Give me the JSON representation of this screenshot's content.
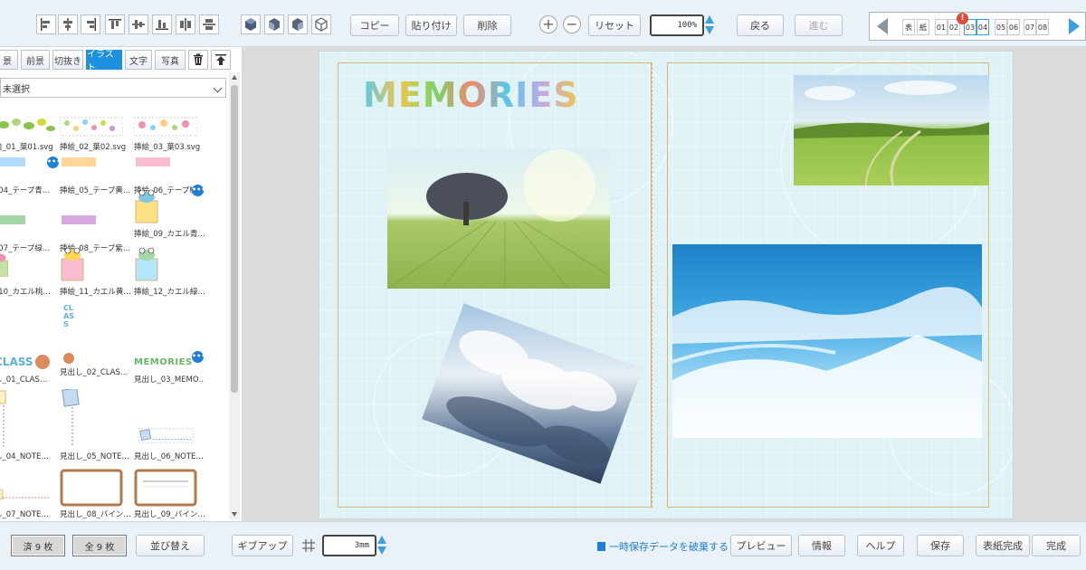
{
  "toolbar": {
    "align_icons": [
      "align-left-icon",
      "align-center-h-icon",
      "align-right-icon",
      "align-top-icon",
      "align-center-v-icon",
      "align-bottom-icon",
      "distribute-h-icon",
      "distribute-v-icon"
    ],
    "layer_icons": [
      "bring-to-front-icon",
      "bring-forward-icon",
      "send-backward-icon",
      "send-to-back-icon"
    ],
    "copy": "コピー",
    "paste": "貼り付け",
    "delete": "削除",
    "reset": "リセット",
    "zoom": "100%",
    "back": "戻る",
    "forward": "進む"
  },
  "page_nav": {
    "cover_front": "表",
    "cover_back": "紙",
    "pages": [
      "01",
      "02",
      "03",
      "04",
      "05",
      "06",
      "07",
      "08"
    ],
    "active_pages": [
      "03",
      "04"
    ],
    "alert": "!"
  },
  "left_panel": {
    "tabs": [
      "景",
      "前景",
      "切抜き",
      "イラスト",
      "文字",
      "写真"
    ],
    "active_tab": "イラスト",
    "filter": "未選択",
    "assets": [
      "絵_01_葉01.svg",
      "挿絵_02_葉02.svg",
      "挿絵_03_葉03.svg",
      "_04_テープ青…",
      "挿絵_05_テープ黄…",
      "挿絵_06_テープ桃…",
      "_07_テープ緑…",
      "挿絵_08_テープ紫…",
      "挿絵_09_カエル青…",
      "_10_カエル桃…",
      "挿絵_11_カエル黄…",
      "挿絵_12_カエル緑…",
      "し_01_CLAS…",
      "見出し_02_CLAS…",
      "見出し_03_MEMO…",
      "し_04_NOTE…",
      "見出し_05_NOTE…",
      "見出し_06_NOTE…",
      "し_07_NOTE…",
      "見出し_08_バイン…",
      "見出し_09_バイン…"
    ],
    "thumb_text": {
      "class_h": "CLASS",
      "class_v": "CLASS",
      "memories": "MEMORIES"
    }
  },
  "canvas": {
    "title": "MEMORIES"
  },
  "bottom": {
    "placed": "済 9 枚",
    "total": "全 9 枚",
    "sort": "並び替え",
    "give_up": "ギブアップ",
    "margin": "3mm",
    "discard": "一時保存データを破棄する",
    "preview": "プレビュー",
    "info": "情報",
    "help": "ヘルプ",
    "save": "保存",
    "cover_done": "表紙完成",
    "done": "完成"
  },
  "colors": {
    "accent": "#1e90e0",
    "alert": "#e04a3a",
    "spread_bg": "#dff3f6",
    "guide": "#d8b67a"
  }
}
